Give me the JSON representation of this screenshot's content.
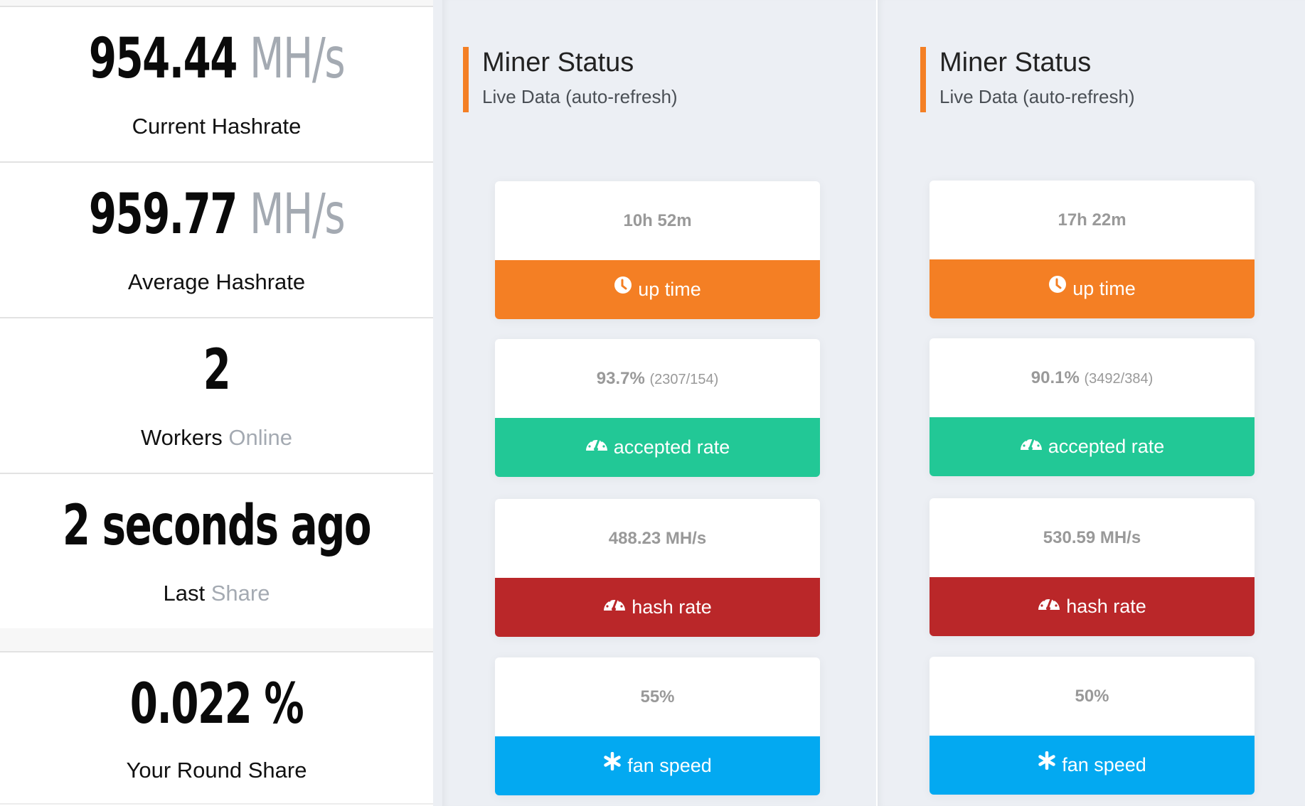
{
  "stats": [
    {
      "value": "954.44",
      "unit": "MH/s",
      "label": "Current Hashrate",
      "label_muted": ""
    },
    {
      "value": "959.77",
      "unit": "MH/s",
      "label": "Average Hashrate",
      "label_muted": ""
    },
    {
      "value": "2",
      "unit": "",
      "label": "Workers",
      "label_muted": "Online"
    },
    {
      "value": "2 seconds ago",
      "unit": "",
      "label": "Last",
      "label_muted": "Share"
    },
    {
      "value": "0.022 %",
      "unit": "",
      "label": "Your Round Share",
      "label_muted": ""
    }
  ],
  "miners": [
    {
      "title": "Miner Status",
      "subtitle": "Live Data (auto-refresh)",
      "cards": [
        {
          "value": "10h 52m",
          "extra": "",
          "label": "up time",
          "icon": "clock-icon",
          "color": "#f47f24"
        },
        {
          "value": "93.7%",
          "extra": "(2307/154)",
          "label": "accepted rate",
          "icon": "gauge-icon",
          "color": "#22c896"
        },
        {
          "value": "488.23 MH/s",
          "extra": "",
          "label": "hash rate",
          "icon": "gauge-icon",
          "color": "#ba2729"
        },
        {
          "value": "55%",
          "extra": "",
          "label": "fan speed",
          "icon": "asterisk-icon",
          "color": "#03a9f1"
        }
      ]
    },
    {
      "title": "Miner Status",
      "subtitle": "Live Data (auto-refresh)",
      "cards": [
        {
          "value": "17h 22m",
          "extra": "",
          "label": "up time",
          "icon": "clock-icon",
          "color": "#f47f24"
        },
        {
          "value": "90.1%",
          "extra": "(3492/384)",
          "label": "accepted rate",
          "icon": "gauge-icon",
          "color": "#22c896"
        },
        {
          "value": "530.59 MH/s",
          "extra": "",
          "label": "hash rate",
          "icon": "gauge-icon",
          "color": "#ba2729"
        },
        {
          "value": "50%",
          "extra": "",
          "label": "fan speed",
          "icon": "asterisk-icon",
          "color": "#03a9f1"
        }
      ]
    }
  ]
}
